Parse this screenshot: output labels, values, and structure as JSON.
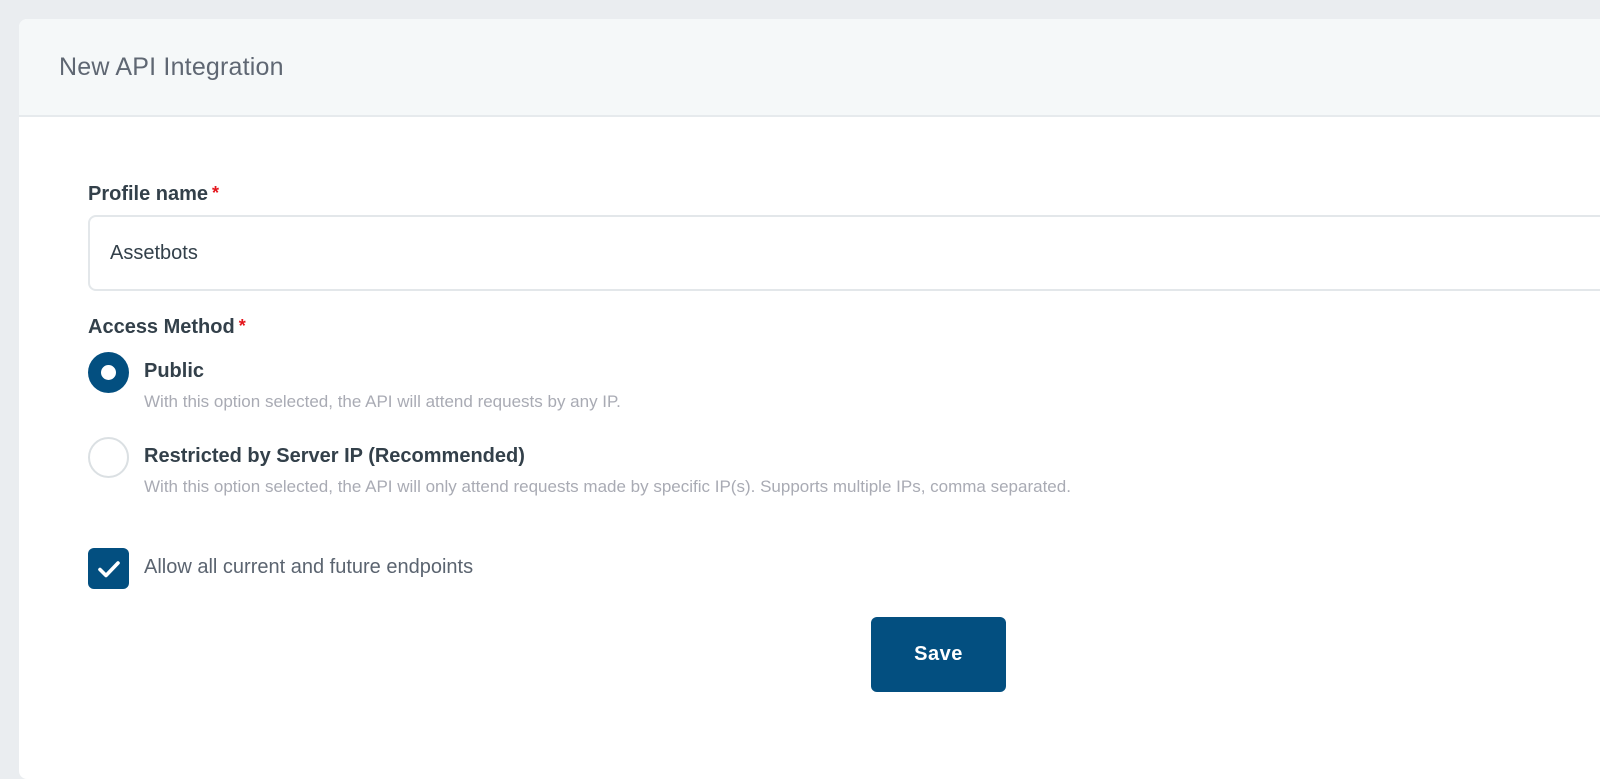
{
  "header": {
    "title": "New API Integration"
  },
  "form": {
    "profile_name": {
      "label": "Profile name",
      "required_mark": "*",
      "value": "Assetbots"
    },
    "access_method": {
      "label": "Access Method",
      "required_mark": "*",
      "options": [
        {
          "title": "Public",
          "description": "With this option selected, the API will attend requests by any IP.",
          "selected": true
        },
        {
          "title": "Restricted by Server IP (Recommended)",
          "description": "With this option selected, the API will only attend requests made by specific IP(s). Supports multiple IPs, comma separated.",
          "selected": false
        }
      ]
    },
    "allow_endpoints": {
      "label": "Allow all current and future endpoints",
      "checked": true
    },
    "save_label": "Save"
  },
  "colors": {
    "primary": "#034f80",
    "required": "#e4141b"
  }
}
